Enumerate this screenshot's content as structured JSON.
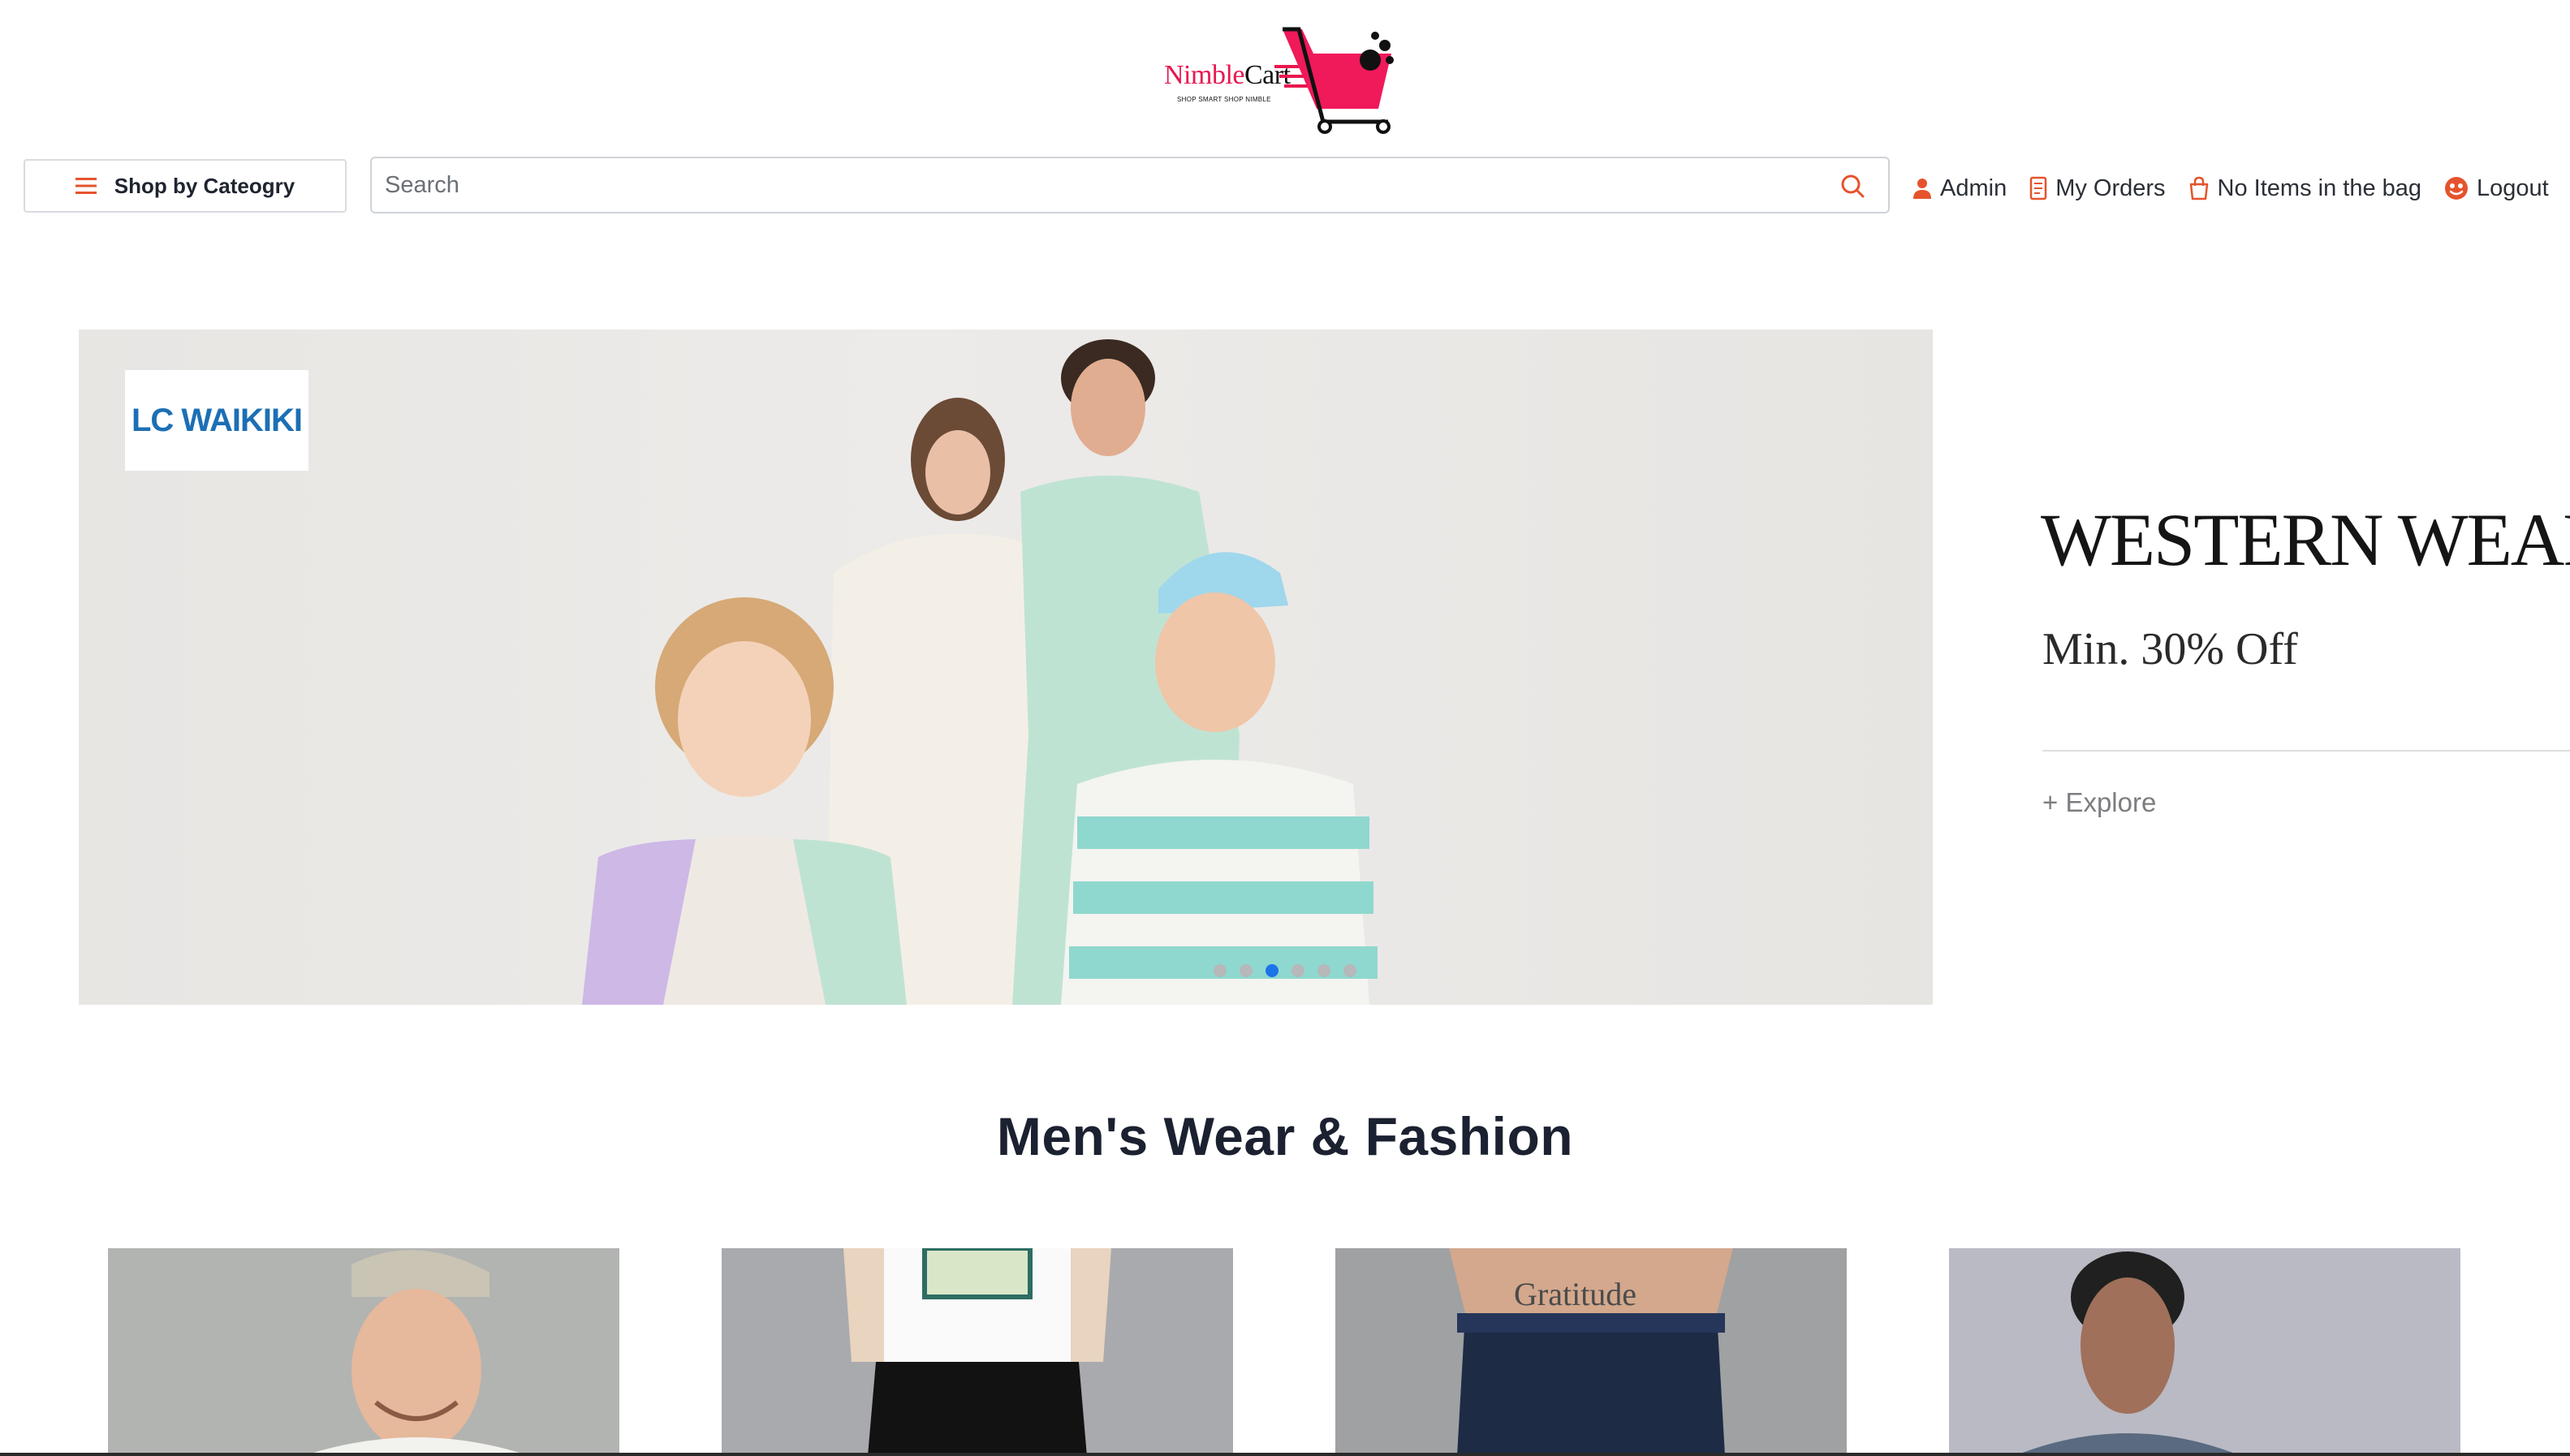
{
  "header": {
    "logo_name_part1": "Nimble",
    "logo_name_part2": "Cart",
    "logo_tagline": "SHOP SMART SHOP NIMBLE"
  },
  "nav": {
    "category_button": "Shop by Cateogry",
    "search_placeholder": "Search",
    "search_value": "",
    "links": {
      "admin": "Admin",
      "orders": "My Orders",
      "bag": "No Items in the bag",
      "logout": "Logout"
    }
  },
  "carousel": {
    "brand_badge": "LC WAIKIKI",
    "active_slide": 3,
    "slide_count": 6,
    "side_promo": {
      "title": "WESTERN WEAR",
      "subtitle": "Min. 30% Off",
      "cta": "+ Explore"
    }
  },
  "section": {
    "title": "Men's Wear & Fashion"
  },
  "colors": {
    "accent": "#e5532d",
    "brand_pink": "#e8174f",
    "active_dot": "#1d73e8"
  },
  "icons": {
    "menu": "hamburger-icon",
    "search": "search-icon",
    "admin": "user-icon",
    "orders": "receipt-icon",
    "bag": "bag-icon",
    "logout": "logout-smiley-icon"
  }
}
